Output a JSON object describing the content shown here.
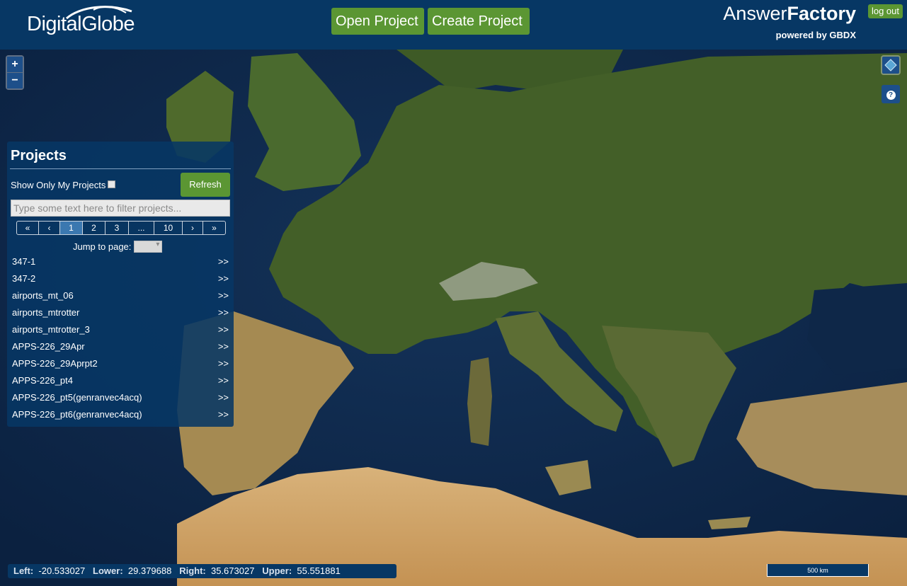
{
  "header": {
    "logo_text": "DigitalGlobe",
    "open_project_label": "Open Project",
    "create_project_label": "Create Project",
    "brand_light": "Answer",
    "brand_bold": "Factory",
    "powered_by": "powered by GBDX",
    "logout_label": "log out"
  },
  "map": {
    "zoom_in": "+",
    "zoom_out": "−",
    "help": "?"
  },
  "panel": {
    "title": "Projects",
    "show_only_mine_label": "Show Only My Projects",
    "refresh_label": "Refresh",
    "filter_placeholder": "Type some text here to filter projects...",
    "pager": [
      "«",
      "‹",
      "1",
      "2",
      "3",
      "...",
      "10",
      "›",
      "»"
    ],
    "active_page": "1",
    "jump_label": "Jump to page:",
    "projects": [
      {
        "name": "347-1",
        "arrow": ">>"
      },
      {
        "name": "347-2",
        "arrow": ">>"
      },
      {
        "name": "airports_mt_06",
        "arrow": ">>"
      },
      {
        "name": "airports_mtrotter",
        "arrow": ">>"
      },
      {
        "name": "airports_mtrotter_3",
        "arrow": ">>"
      },
      {
        "name": "APPS-226_29Apr",
        "arrow": ">>"
      },
      {
        "name": "APPS-226_29Aprpt2",
        "arrow": ">>"
      },
      {
        "name": "APPS-226_pt4",
        "arrow": ">>"
      },
      {
        "name": "APPS-226_pt5(genranvec4acq)",
        "arrow": ">>"
      },
      {
        "name": "APPS-226_pt6(genranvec4acq)",
        "arrow": ">>"
      }
    ]
  },
  "extent": {
    "left_label": "Left:",
    "left_value": "-20.533027",
    "lower_label": "Lower:",
    "lower_value": "29.379688",
    "right_label": "Right:",
    "right_value": "35.673027",
    "upper_label": "Upper:",
    "upper_value": "55.551881"
  },
  "scale_label": "500 km",
  "colors": {
    "header_bg": "#073764",
    "button_green": "#5b9633",
    "sea": "#0d2a4a",
    "land": "#3f5a26",
    "desert": "#c9a46a"
  }
}
